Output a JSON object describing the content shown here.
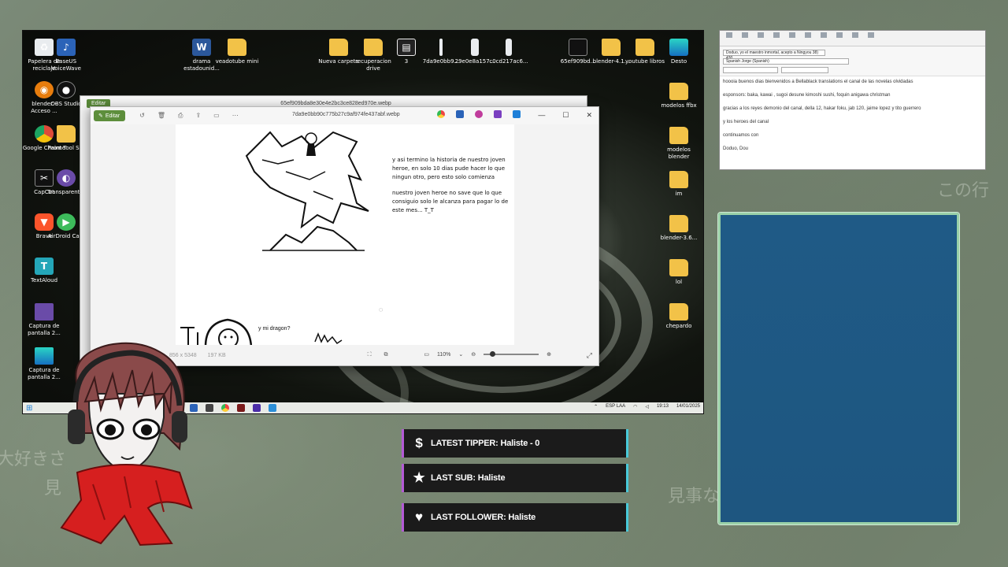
{
  "background_text": [
    "大好きさ",
    "見",
    "見事な",
    "この行"
  ],
  "desktop": {
    "icons_left": [
      {
        "label": "Papelera de reciclaje",
        "icon": "recycle-bin-icon"
      },
      {
        "label": "EaseUS VoiceWave",
        "icon": "easeus-icon"
      },
      {
        "label": "blender - Acceso ...",
        "icon": "blender-icon"
      },
      {
        "label": "OBS Studio",
        "icon": "obs-icon"
      },
      {
        "label": "Google Chrome",
        "icon": "chrome-icon"
      },
      {
        "label": "Paint Tool S...",
        "icon": "folder-icon"
      },
      {
        "label": "CapCut",
        "icon": "capcut-icon"
      },
      {
        "label": "Transparent...",
        "icon": "app-icon"
      },
      {
        "label": "Brave",
        "icon": "brave-icon"
      },
      {
        "label": "AirDroid Cast",
        "icon": "airdroid-icon"
      },
      {
        "label": "TextAloud",
        "icon": "textaloud-icon"
      },
      {
        "label": "Captura de pantalla 2...",
        "icon": "image-icon"
      },
      {
        "label": "Captura de pantalla 2...",
        "icon": "image-icon"
      }
    ],
    "icons_top": [
      {
        "label": "drama estadounid...",
        "icon": "word-icon"
      },
      {
        "label": "veadotube mini",
        "icon": "folder-icon"
      },
      {
        "label": "Nueva carpeta",
        "icon": "folder-icon"
      },
      {
        "label": "recuperacion drive",
        "icon": "folder-icon"
      },
      {
        "label": "3",
        "icon": "file-icon"
      },
      {
        "label": "7da9e0bb9...",
        "icon": "file-icon"
      },
      {
        "label": "29e0e8a157...",
        "icon": "file-icon"
      },
      {
        "label": "c0cd217ac6...",
        "icon": "file-icon"
      },
      {
        "label": "65ef909bd...",
        "icon": "image-icon"
      },
      {
        "label": "blender-4.1...",
        "icon": "folder-icon"
      },
      {
        "label": "youtube libros",
        "icon": "folder-icon"
      },
      {
        "label": "Desto",
        "icon": "app-icon"
      }
    ],
    "icons_right": [
      {
        "label": "modelos ffbx",
        "icon": "folder-icon"
      },
      {
        "label": "modelos blender",
        "icon": "folder-icon"
      },
      {
        "label": "im",
        "icon": "folder-icon"
      },
      {
        "label": "blender-3.6...",
        "icon": "folder-icon"
      },
      {
        "label": "lol",
        "icon": "folder-icon"
      },
      {
        "label": "chepardo",
        "icon": "folder-icon"
      }
    ],
    "back_window": {
      "edit_label": "Editar",
      "title": "65ef909bda8e30e4e2bc3ce828ed970e.webp"
    },
    "viewer": {
      "edit_label": "Editar",
      "title": "7da9e0bb90c775b27c9af974fe437abf.webp",
      "story_p1": "y asi termino la historia de nuestro joven heroe, en solo 10 dias pude hacer lo que ningun otro, pero esto solo comienza",
      "story_p2": "nuestro joven heroe no save que lo que consiguio solo le alcanza para pagar lo de este mes... T_T",
      "dragon_question": "y mi dragon?",
      "dimensions": "856 x 5348",
      "filesize": "197 KB",
      "zoom": "110%"
    },
    "taskbar": {
      "lang": "ESP LAA",
      "time": "19:13",
      "date": "14/01/2025"
    }
  },
  "notepad": {
    "title_line": "Doduo, yo el maestro inmortal, acepto a Ningyou 38) 430",
    "voice": "Spanish Jorge (Spanish)",
    "lines": [
      "hoooia buenos dias bienvenidos a Bellablack translations el canal de las novelas olvidadas",
      "esponsors: baka, kawai , sugoi desune kimoshi sushi, foquin anigawa christman",
      "gracias a los reyes demonio del canal, della 12, hakar foku, jab 120, jaime lopez y tito guerrero",
      "y los heroes del canal",
      "continuamos con",
      "Doduo, Dou"
    ]
  },
  "alerts": {
    "tipper": {
      "icon": "dollar-icon",
      "text": "LATEST TIPPER: Haliste - 0"
    },
    "sub": {
      "icon": "star-icon",
      "text": "LAST SUB: Haliste"
    },
    "follower": {
      "icon": "heart-icon",
      "text": "LAST FOLLOWER: Haliste"
    }
  },
  "colors": {
    "overlay_bg": "#6f7d6c",
    "panel_blue": "#1f5a86",
    "panel_border": "#9ad1a8",
    "alert_bg": "#1b1b1b",
    "alert_left": "#b45ad6",
    "alert_right": "#48c9d9",
    "edit_green": "#5d8e3c"
  }
}
